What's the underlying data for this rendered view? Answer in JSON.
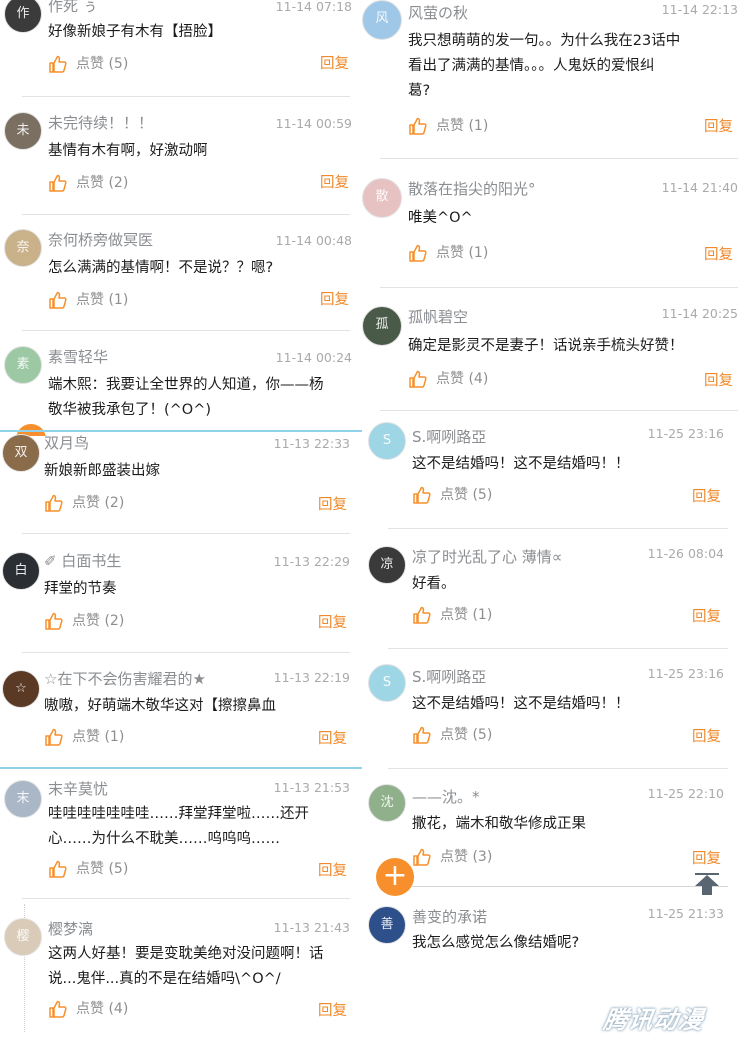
{
  "ui": {
    "like_label": "点赞",
    "reply_label": "回复",
    "fab_plus": "+",
    "watermark": "腾讯动漫"
  },
  "colors": {
    "accent_orange": "#f7902c",
    "reply_orange": "#ef8a2c",
    "username_gray": "#8a8d91",
    "time_gray": "#aaaaaa",
    "divider": "#e3e3e3",
    "highlight_blue": "#8fd3ea"
  },
  "left_comments": [
    {
      "user": "作死 ぅ",
      "time": "11-14 07:18",
      "text": "好像新娘子有木有【捂脸】",
      "likes": "(5)",
      "avatar_color": "#3b3b3b",
      "avatar_initial": "作"
    },
    {
      "user": "未完待续！！！",
      "time": "11-14 00:59",
      "text": "基情有木有啊，好激动啊",
      "likes": "(2)",
      "avatar_color": "#7b6f62",
      "avatar_initial": "未"
    },
    {
      "user": "奈何桥旁做冥医",
      "time": "11-14 00:48",
      "text": "怎么满满的基情啊！不是说？？嗯?",
      "likes": "(1)",
      "avatar_color": "#c9b28a",
      "avatar_initial": "奈"
    },
    {
      "user": "素雪轻华",
      "time": "11-14 00:24",
      "text": "端木熙：我要让全世界的人知道，你——杨\n敬华被我承包了！(^O^)",
      "likes": "",
      "avatar_color": "#9cc9a4",
      "avatar_initial": "素"
    },
    {
      "user": "双月鸟",
      "time": "11-13 22:33",
      "text": "新娘新郎盛装出嫁",
      "likes": "(2)",
      "avatar_color": "#8a6b4a",
      "avatar_initial": "双"
    },
    {
      "user": "✐ 白面书生",
      "time": "11-13 22:29",
      "text": "拜堂的节奏",
      "likes": "(2)",
      "avatar_color": "#2b2e33",
      "avatar_initial": "白"
    },
    {
      "user": "☆在下不会伤害耀君的★",
      "time": "11-13 22:19",
      "text": "嗷嗷，好萌端木敬华这对【擦擦鼻血",
      "likes": "(1)",
      "avatar_color": "#5a3a24",
      "avatar_initial": "☆"
    },
    {
      "user": "末辛莫忧",
      "time": "11-13 21:53",
      "text": "哇哇哇哇哇哇哇……拜堂拜堂啦……还开\n心……为什么不耽美……呜呜呜……",
      "likes": "(5)",
      "avatar_color": "#a9b7c6",
      "avatar_initial": "末"
    },
    {
      "user": "樱梦漓",
      "time": "11-13 21:43",
      "text": "这两人好基！要是变耽美绝对没问题啊！话\n说...鬼伴...真的不是在结婚吗\\^O^/",
      "likes": "(4)",
      "avatar_color": "#d9cbb8",
      "avatar_initial": "樱"
    }
  ],
  "right_comments": [
    {
      "user": "风萤の秋",
      "time": "11-14 22:13",
      "text": "我只想萌萌的发一句。。为什么我在23话中\n看出了满满的基情。。。人鬼妖的爱恨纠\n葛?",
      "likes": "(1)",
      "avatar_color": "#9fc8e8",
      "avatar_initial": "风"
    },
    {
      "user": "散落在指尖的阳光°",
      "time": "11-14 21:40",
      "text": "唯美^O^",
      "likes": "(1)",
      "avatar_color": "#e7c2c2",
      "avatar_initial": "散"
    },
    {
      "user": "孤帆碧空",
      "time": "11-14 20:25",
      "text": "确定是影灵不是妻子！话说亲手梳头好赞！",
      "likes": "(4)",
      "avatar_color": "#4a5a48",
      "avatar_initial": "孤"
    },
    {
      "user": "S.啊咧路亞",
      "time": "11-25 23:16",
      "text": "这不是结婚吗！这不是结婚吗！！",
      "likes": "(5)",
      "avatar_color": "#9fd6e6",
      "avatar_initial": "S"
    },
    {
      "user": "凉了时光乱了心 薄情∝",
      "time": "11-26 08:04",
      "text": "好看。",
      "likes": "(1)",
      "avatar_color": "#3a3a3a",
      "avatar_initial": "凉"
    },
    {
      "user": "S.啊咧路亞",
      "time": "11-25 23:16",
      "text": "这不是结婚吗！这不是结婚吗！！",
      "likes": "(5)",
      "avatar_color": "#9fd6e6",
      "avatar_initial": "S"
    },
    {
      "user": "——沈。*",
      "time": "11-25 22:10",
      "text": "撒花，端木和敬华修成正果",
      "likes": "(3)",
      "avatar_color": "#8fb08a",
      "avatar_initial": "沈"
    },
    {
      "user": "善变的承诺",
      "time": "11-25 21:33",
      "text": "我怎么感觉怎么像结婚呢?",
      "likes": "",
      "avatar_color": "#2d4f8a",
      "avatar_initial": "善"
    }
  ]
}
